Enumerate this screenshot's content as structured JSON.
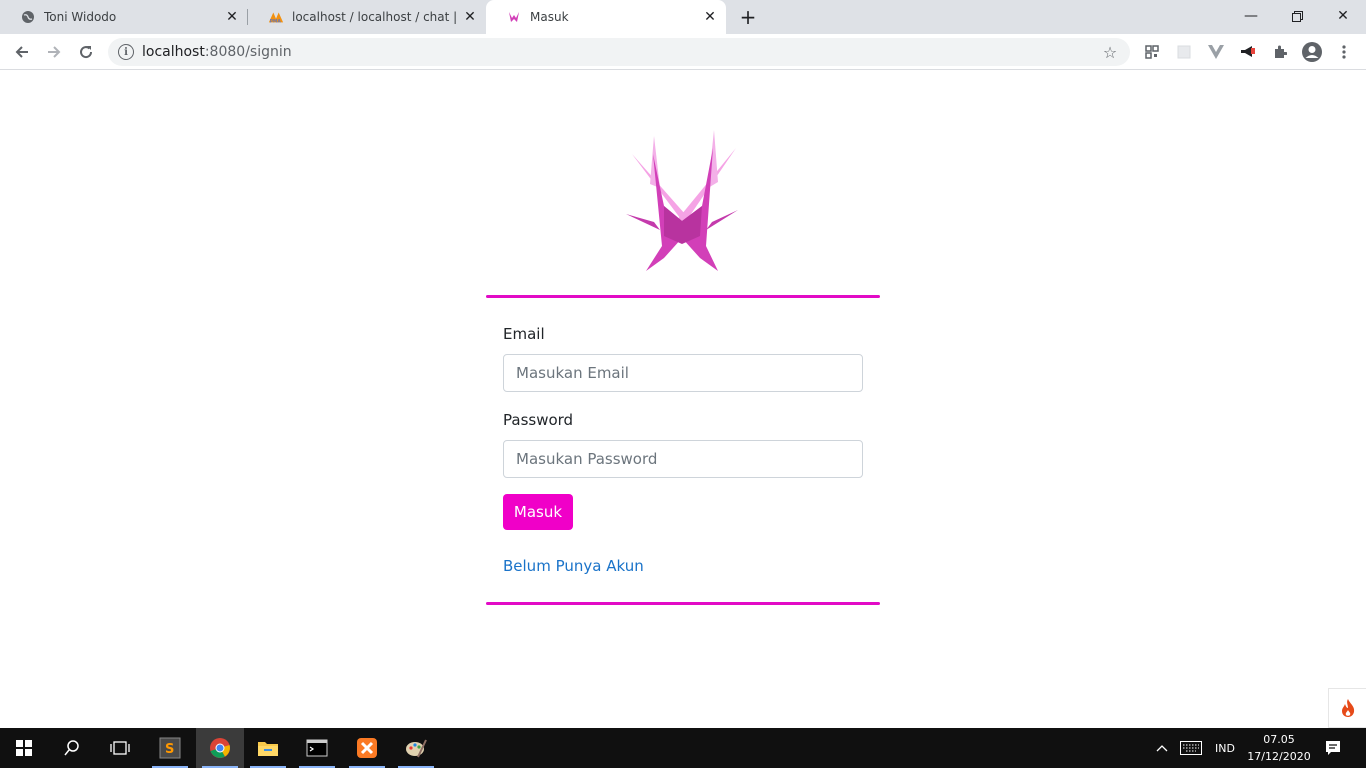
{
  "browser": {
    "tabs": [
      {
        "title": "Toni Widodo",
        "icon": "globe-icon",
        "active": false
      },
      {
        "title": "localhost / localhost / chat | phpM",
        "icon": "phpmyadmin-icon",
        "active": false
      },
      {
        "title": "Masuk",
        "icon": "site-logo-icon",
        "active": true
      }
    ],
    "new_tab_label": "+",
    "url_host": "localhost",
    "url_path": ":8080/signin"
  },
  "page": {
    "email_label": "Email",
    "email_placeholder": "Masukan Email",
    "password_label": "Password",
    "password_placeholder": "Masukan Password",
    "submit_label": "Masuk",
    "register_link": "Belum Punya Akun",
    "accent_color": "#f000c8"
  },
  "taskbar": {
    "language": "IND",
    "time": "07.05",
    "date": "17/12/2020"
  }
}
